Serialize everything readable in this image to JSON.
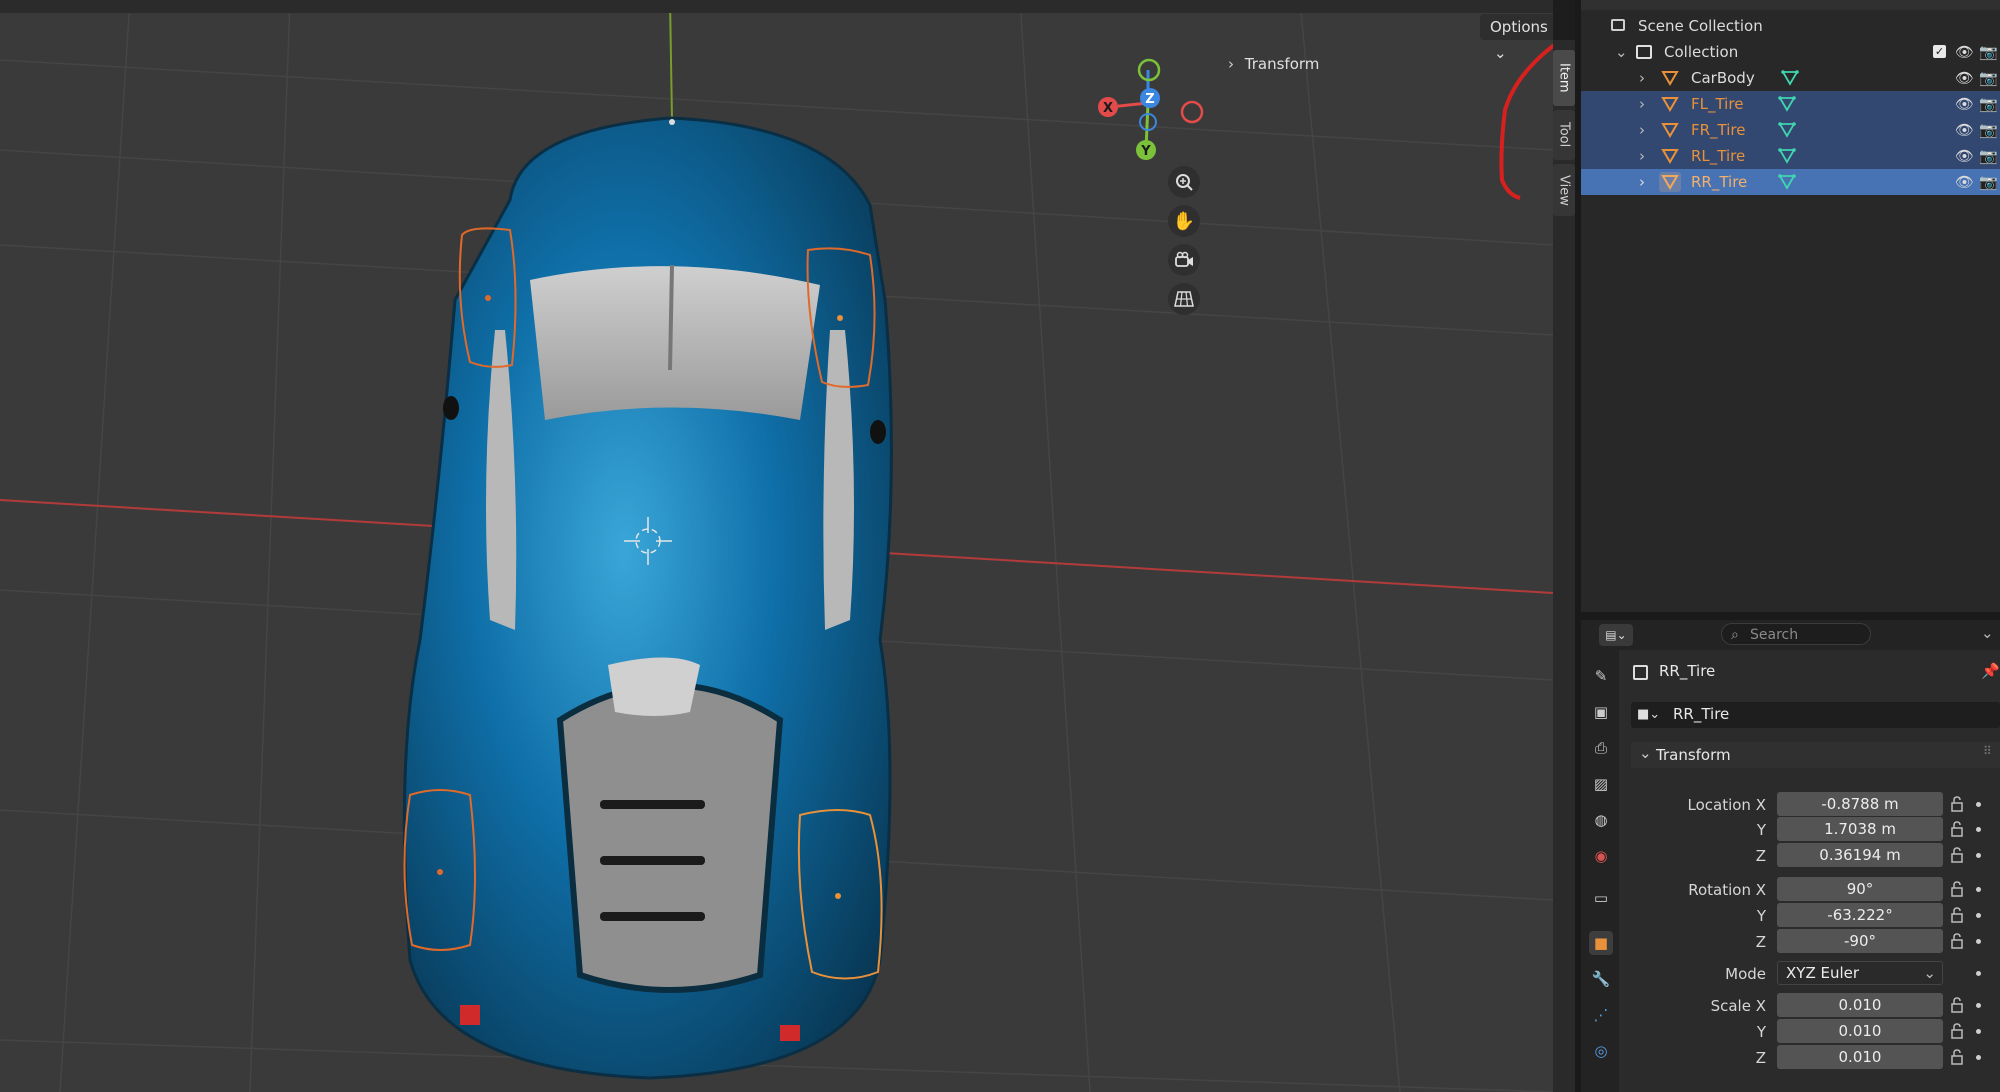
{
  "viewport": {
    "options_label": "Options",
    "transform_panel_label": "Transform",
    "gizmo": {
      "x": "X",
      "y": "Y",
      "z": "Z"
    },
    "nav_icons": [
      "zoom-icon",
      "hand-pan-icon",
      "camera-icon",
      "grid-icon"
    ]
  },
  "side_tabs": [
    "Item",
    "Tool",
    "View"
  ],
  "outliner": {
    "scene_collection": "Scene Collection",
    "collection": "Collection",
    "objects": [
      {
        "name": "CarBody",
        "state": "normal"
      },
      {
        "name": "FL_Tire",
        "state": "selected"
      },
      {
        "name": "FR_Tire",
        "state": "selected"
      },
      {
        "name": "RL_Tire",
        "state": "selected"
      },
      {
        "name": "RR_Tire",
        "state": "active"
      }
    ]
  },
  "properties": {
    "search_placeholder": "Search",
    "object_name": "RR_Tire",
    "object_datablock": "RR_Tire",
    "transform_label": "Transform",
    "location": {
      "label": "Location X",
      "x": "-0.8788 m",
      "y": "1.7038 m",
      "z": "0.36194 m"
    },
    "rotation": {
      "label": "Rotation X",
      "x": "90°",
      "y": "-63.222°",
      "z": "-90°"
    },
    "mode": {
      "label": "Mode",
      "value": "XYZ Euler"
    },
    "scale": {
      "label": "Scale X",
      "x": "0.010",
      "y": "0.010",
      "z": "0.010"
    },
    "axis_y": "Y",
    "axis_z": "Z"
  },
  "colors": {
    "accent_active": "#4772b3",
    "selected_row": "#334870",
    "object_orange": "#e8913a",
    "selection_outline": "#e06a2a",
    "car_blue": "#0f6fa8"
  }
}
